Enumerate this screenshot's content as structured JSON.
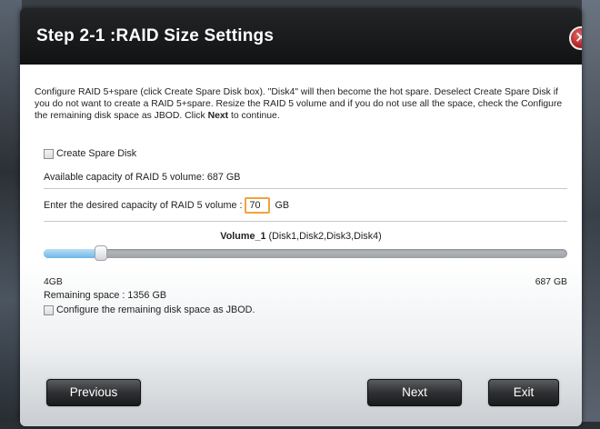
{
  "dialog": {
    "title": "Step 2-1 :RAID Size Settings",
    "close_symbol": "✕",
    "instructions": {
      "part1": "Configure RAID 5+spare (click Create Spare Disk box). \"Disk4\" will then become the hot spare. Deselect Create Spare Disk if you do not want to create a RAID 5+spare. Resize the RAID 5 volume and if you do not use all the space, check the Configure the remaining disk space as JBOD. Click ",
      "bold": "Next",
      "part2": " to continue."
    },
    "spare_checkbox": {
      "label": "Create Spare Disk",
      "checked": false
    },
    "available_capacity": "Available capacity of RAID 5 volume: 687 GB",
    "capacity_prompt": "Enter the desired capacity of RAID 5 volume :",
    "capacity_value": "70",
    "capacity_unit": "GB",
    "volume": {
      "name": "Volume_1",
      "disks": " (Disk1,Disk2,Disk3,Disk4)"
    },
    "slider": {
      "min_label": "4GB",
      "max_label": "687 GB",
      "min": 4,
      "max": 687,
      "value": 70
    },
    "remaining": "Remaining space : 1356 GB",
    "jbod_checkbox": {
      "label": "Configure the remaining disk space as JBOD.",
      "checked": false
    },
    "buttons": {
      "previous": "Previous",
      "next": "Next",
      "exit": "Exit"
    }
  },
  "colors": {
    "accent_input_border": "#f2a33a",
    "slider_fill": "#6cb6e6",
    "close_red": "#b42525"
  }
}
